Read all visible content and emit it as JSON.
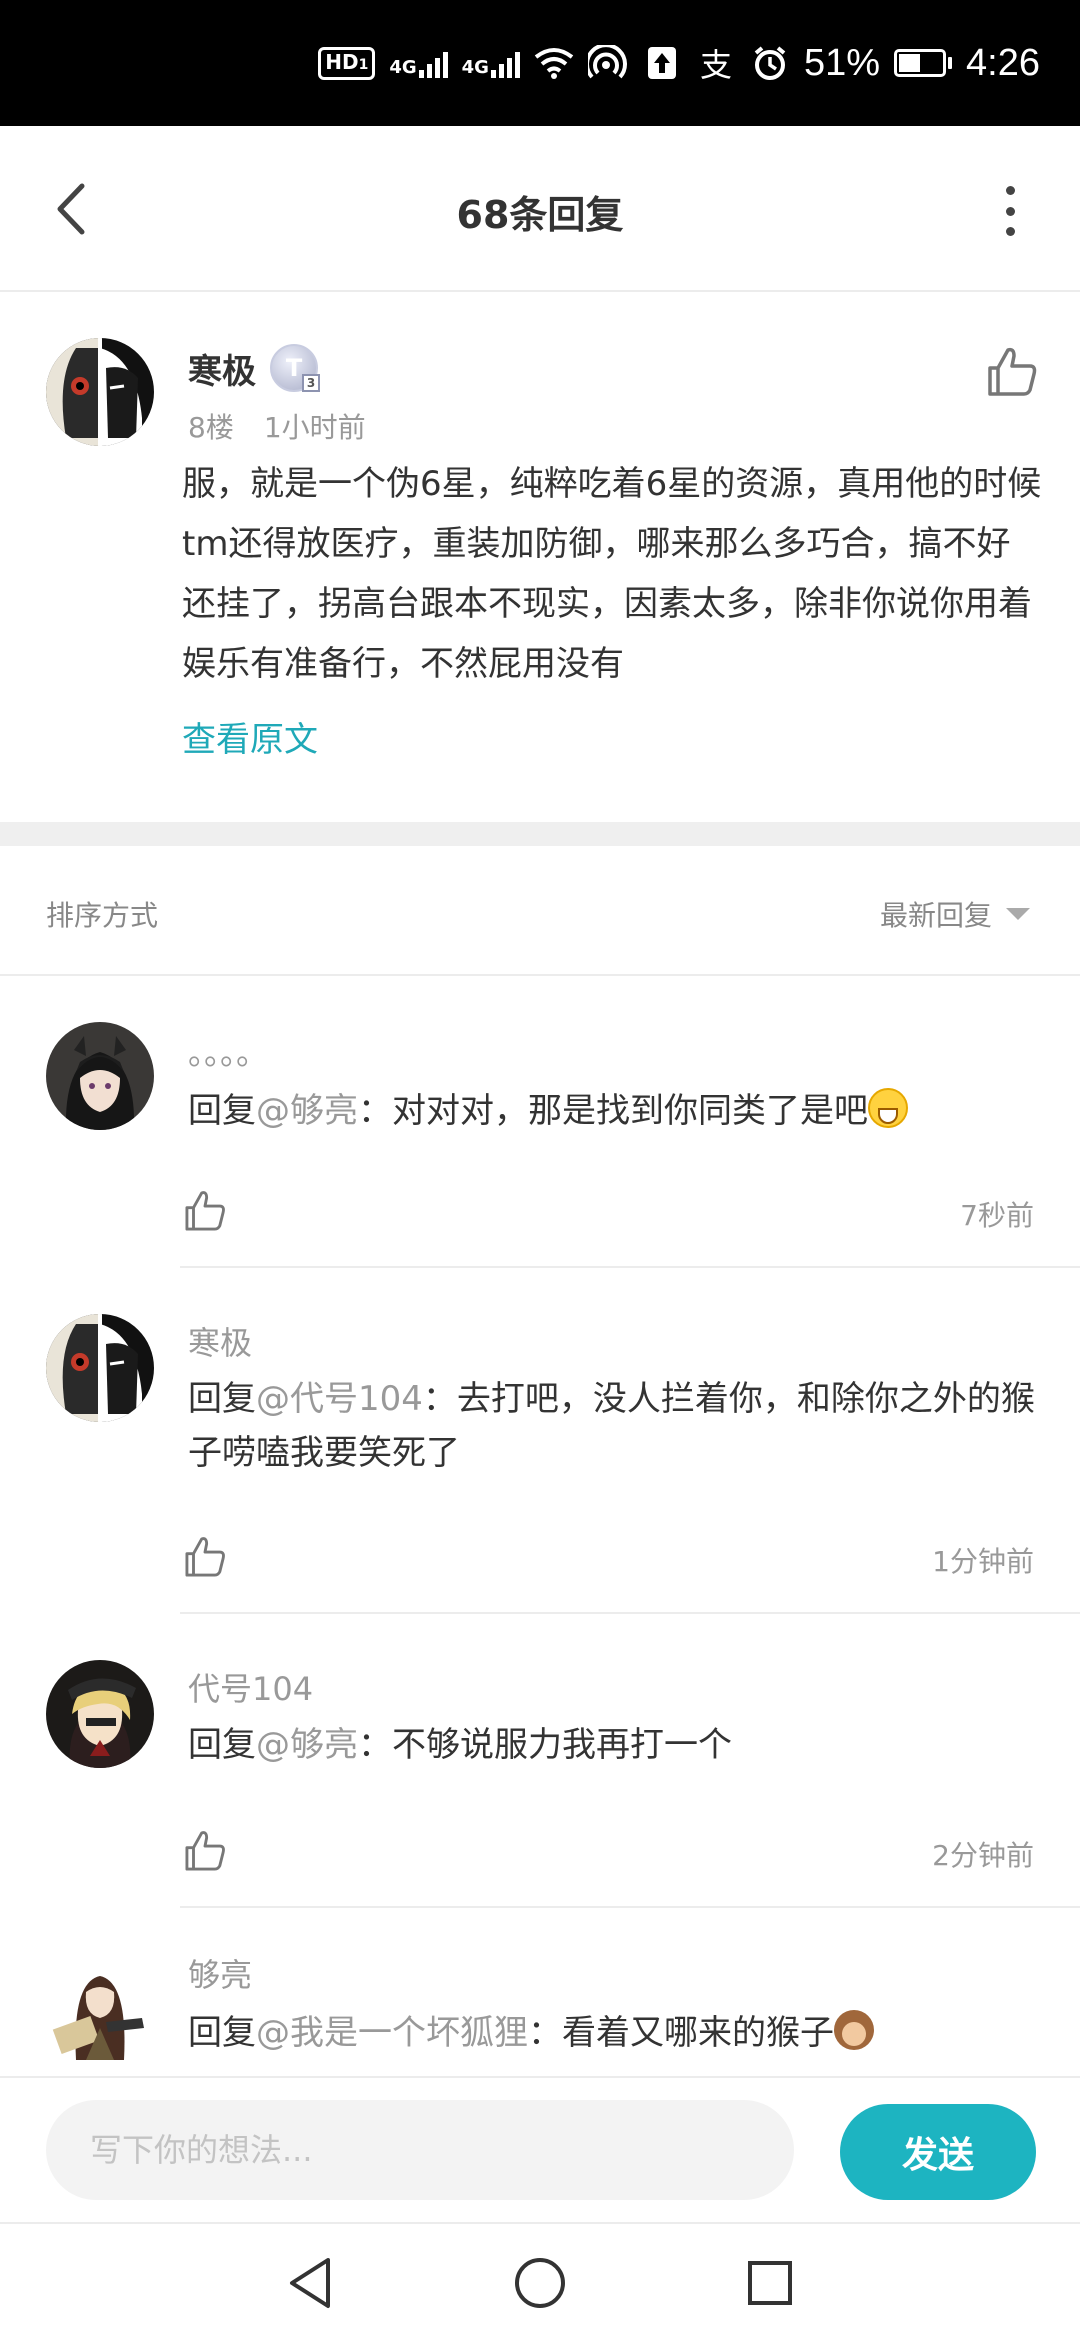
{
  "status_bar": {
    "hd": "HD",
    "sim": "1",
    "net1": "4G",
    "net2": "4G",
    "wifi_sub": "6",
    "hotspot_sub": "1",
    "battery_percent": "51%",
    "battery_level": 0.51,
    "time": "4:26"
  },
  "header": {
    "title": "68条回复"
  },
  "post": {
    "author": "寒极",
    "level_badge": "T",
    "level_sub": "3",
    "floor": "8楼",
    "time": "1小时前",
    "body": "服，就是一个伪6星，纯粹吃着6星的资源，真用他的时候tm还得放医疗，重装加防御，哪来那么多巧合，搞不好还挂了，拐高台跟本不现实，因素太多，除非你说你用着娱乐有准备行，不然屁用没有",
    "view_original": "查看原文"
  },
  "sort": {
    "label": "排序方式",
    "value": "最新回复"
  },
  "replies": [
    {
      "name": "。。。。",
      "prefix": "回复",
      "mention": "@够亮",
      "text": "：对对对，那是找到你同类了是吧",
      "time": "7秒前"
    },
    {
      "name": "寒极",
      "prefix": "回复",
      "mention": "@代号104",
      "text": "：去打吧，没人拦着你，和除你之外的猴子唠嗑我要笑死了",
      "time": "1分钟前"
    },
    {
      "name": "代号104",
      "prefix": "回复",
      "mention": "@够亮",
      "text": "：不够说服力我再打一个",
      "time": "2分钟前"
    },
    {
      "name": "够亮",
      "prefix": "回复",
      "mention": "@我是一个坏狐狸",
      "text": "：看着又哪来的猴子",
      "time": ""
    }
  ],
  "input": {
    "placeholder": "写下你的想法...",
    "send_label": "发送"
  },
  "colors": {
    "accent": "#1db4c1",
    "link": "#1fa9b8",
    "muted": "#999999"
  }
}
